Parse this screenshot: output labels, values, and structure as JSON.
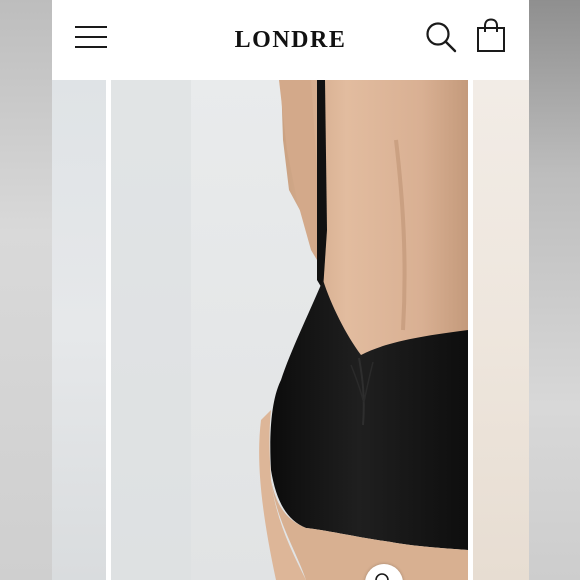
{
  "header": {
    "logo_text": "LONDRE",
    "menu_icon": "hamburger-menu-icon",
    "search_icon": "search-icon",
    "cart_icon": "shopping-bag-icon"
  },
  "gallery": {
    "main_image_alt": "",
    "zoom_icon": "zoom-icon"
  },
  "colors": {
    "background": "#ffffff",
    "icon": "#1a1a1a",
    "garment": "#141414",
    "skin": "#d9b295"
  }
}
